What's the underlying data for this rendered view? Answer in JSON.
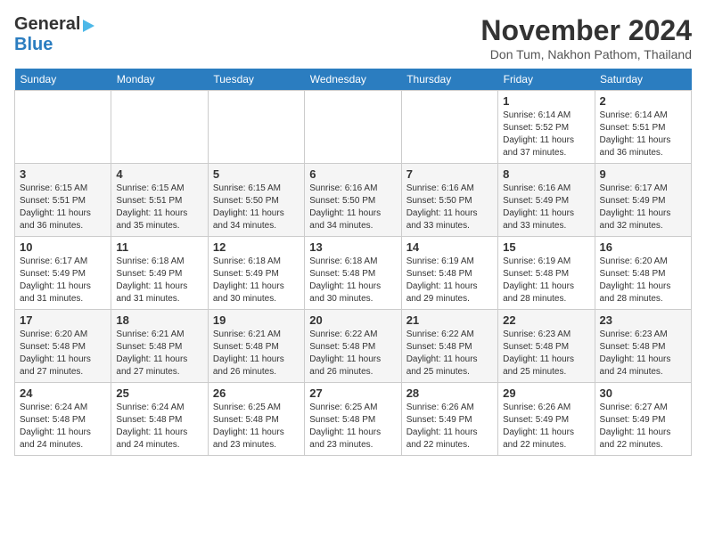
{
  "logo": {
    "line1": "General",
    "line2": "Blue"
  },
  "header": {
    "title": "November 2024",
    "subtitle": "Don Tum, Nakhon Pathom, Thailand"
  },
  "weekdays": [
    "Sunday",
    "Monday",
    "Tuesday",
    "Wednesday",
    "Thursday",
    "Friday",
    "Saturday"
  ],
  "weeks": [
    [
      {
        "day": "",
        "info": ""
      },
      {
        "day": "",
        "info": ""
      },
      {
        "day": "",
        "info": ""
      },
      {
        "day": "",
        "info": ""
      },
      {
        "day": "",
        "info": ""
      },
      {
        "day": "1",
        "info": "Sunrise: 6:14 AM\nSunset: 5:52 PM\nDaylight: 11 hours and 37 minutes."
      },
      {
        "day": "2",
        "info": "Sunrise: 6:14 AM\nSunset: 5:51 PM\nDaylight: 11 hours and 36 minutes."
      }
    ],
    [
      {
        "day": "3",
        "info": "Sunrise: 6:15 AM\nSunset: 5:51 PM\nDaylight: 11 hours and 36 minutes."
      },
      {
        "day": "4",
        "info": "Sunrise: 6:15 AM\nSunset: 5:51 PM\nDaylight: 11 hours and 35 minutes."
      },
      {
        "day": "5",
        "info": "Sunrise: 6:15 AM\nSunset: 5:50 PM\nDaylight: 11 hours and 34 minutes."
      },
      {
        "day": "6",
        "info": "Sunrise: 6:16 AM\nSunset: 5:50 PM\nDaylight: 11 hours and 34 minutes."
      },
      {
        "day": "7",
        "info": "Sunrise: 6:16 AM\nSunset: 5:50 PM\nDaylight: 11 hours and 33 minutes."
      },
      {
        "day": "8",
        "info": "Sunrise: 6:16 AM\nSunset: 5:49 PM\nDaylight: 11 hours and 33 minutes."
      },
      {
        "day": "9",
        "info": "Sunrise: 6:17 AM\nSunset: 5:49 PM\nDaylight: 11 hours and 32 minutes."
      }
    ],
    [
      {
        "day": "10",
        "info": "Sunrise: 6:17 AM\nSunset: 5:49 PM\nDaylight: 11 hours and 31 minutes."
      },
      {
        "day": "11",
        "info": "Sunrise: 6:18 AM\nSunset: 5:49 PM\nDaylight: 11 hours and 31 minutes."
      },
      {
        "day": "12",
        "info": "Sunrise: 6:18 AM\nSunset: 5:49 PM\nDaylight: 11 hours and 30 minutes."
      },
      {
        "day": "13",
        "info": "Sunrise: 6:18 AM\nSunset: 5:48 PM\nDaylight: 11 hours and 30 minutes."
      },
      {
        "day": "14",
        "info": "Sunrise: 6:19 AM\nSunset: 5:48 PM\nDaylight: 11 hours and 29 minutes."
      },
      {
        "day": "15",
        "info": "Sunrise: 6:19 AM\nSunset: 5:48 PM\nDaylight: 11 hours and 28 minutes."
      },
      {
        "day": "16",
        "info": "Sunrise: 6:20 AM\nSunset: 5:48 PM\nDaylight: 11 hours and 28 minutes."
      }
    ],
    [
      {
        "day": "17",
        "info": "Sunrise: 6:20 AM\nSunset: 5:48 PM\nDaylight: 11 hours and 27 minutes."
      },
      {
        "day": "18",
        "info": "Sunrise: 6:21 AM\nSunset: 5:48 PM\nDaylight: 11 hours and 27 minutes."
      },
      {
        "day": "19",
        "info": "Sunrise: 6:21 AM\nSunset: 5:48 PM\nDaylight: 11 hours and 26 minutes."
      },
      {
        "day": "20",
        "info": "Sunrise: 6:22 AM\nSunset: 5:48 PM\nDaylight: 11 hours and 26 minutes."
      },
      {
        "day": "21",
        "info": "Sunrise: 6:22 AM\nSunset: 5:48 PM\nDaylight: 11 hours and 25 minutes."
      },
      {
        "day": "22",
        "info": "Sunrise: 6:23 AM\nSunset: 5:48 PM\nDaylight: 11 hours and 25 minutes."
      },
      {
        "day": "23",
        "info": "Sunrise: 6:23 AM\nSunset: 5:48 PM\nDaylight: 11 hours and 24 minutes."
      }
    ],
    [
      {
        "day": "24",
        "info": "Sunrise: 6:24 AM\nSunset: 5:48 PM\nDaylight: 11 hours and 24 minutes."
      },
      {
        "day": "25",
        "info": "Sunrise: 6:24 AM\nSunset: 5:48 PM\nDaylight: 11 hours and 24 minutes."
      },
      {
        "day": "26",
        "info": "Sunrise: 6:25 AM\nSunset: 5:48 PM\nDaylight: 11 hours and 23 minutes."
      },
      {
        "day": "27",
        "info": "Sunrise: 6:25 AM\nSunset: 5:48 PM\nDaylight: 11 hours and 23 minutes."
      },
      {
        "day": "28",
        "info": "Sunrise: 6:26 AM\nSunset: 5:49 PM\nDaylight: 11 hours and 22 minutes."
      },
      {
        "day": "29",
        "info": "Sunrise: 6:26 AM\nSunset: 5:49 PM\nDaylight: 11 hours and 22 minutes."
      },
      {
        "day": "30",
        "info": "Sunrise: 6:27 AM\nSunset: 5:49 PM\nDaylight: 11 hours and 22 minutes."
      }
    ]
  ]
}
